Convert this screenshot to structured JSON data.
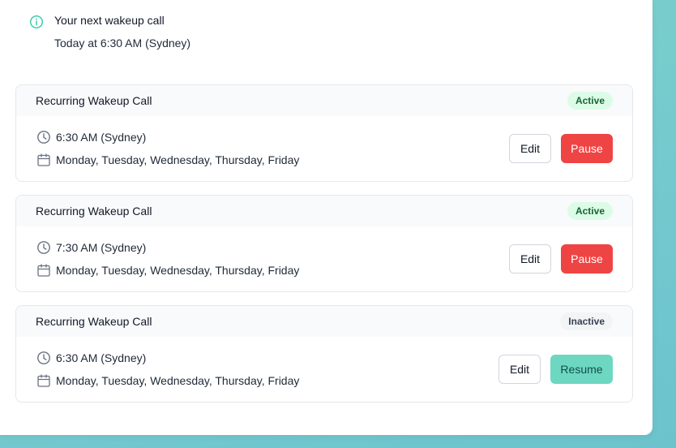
{
  "next_call": {
    "title": "Your next wakeup call",
    "subtitle": "Today at 6:30 AM (Sydney)"
  },
  "colors": {
    "active_badge_bg": "#dcfce7",
    "inactive_badge_bg": "#f3f4f6",
    "pause_button": "#ef4444",
    "resume_button": "#6dd7c1"
  },
  "cards": [
    {
      "title": "Recurring Wakeup Call",
      "status": "Active",
      "time": "6:30 AM (Sydney)",
      "days": "Monday, Tuesday, Wednesday, Thursday, Friday",
      "edit_label": "Edit",
      "action_label": "Pause"
    },
    {
      "title": "Recurring Wakeup Call",
      "status": "Active",
      "time": "7:30 AM (Sydney)",
      "days": "Monday, Tuesday, Wednesday, Thursday, Friday",
      "edit_label": "Edit",
      "action_label": "Pause"
    },
    {
      "title": "Recurring Wakeup Call",
      "status": "Inactive",
      "time": "6:30 AM (Sydney)",
      "days": "Monday, Tuesday, Wednesday, Thursday, Friday",
      "edit_label": "Edit",
      "action_label": "Resume"
    }
  ]
}
